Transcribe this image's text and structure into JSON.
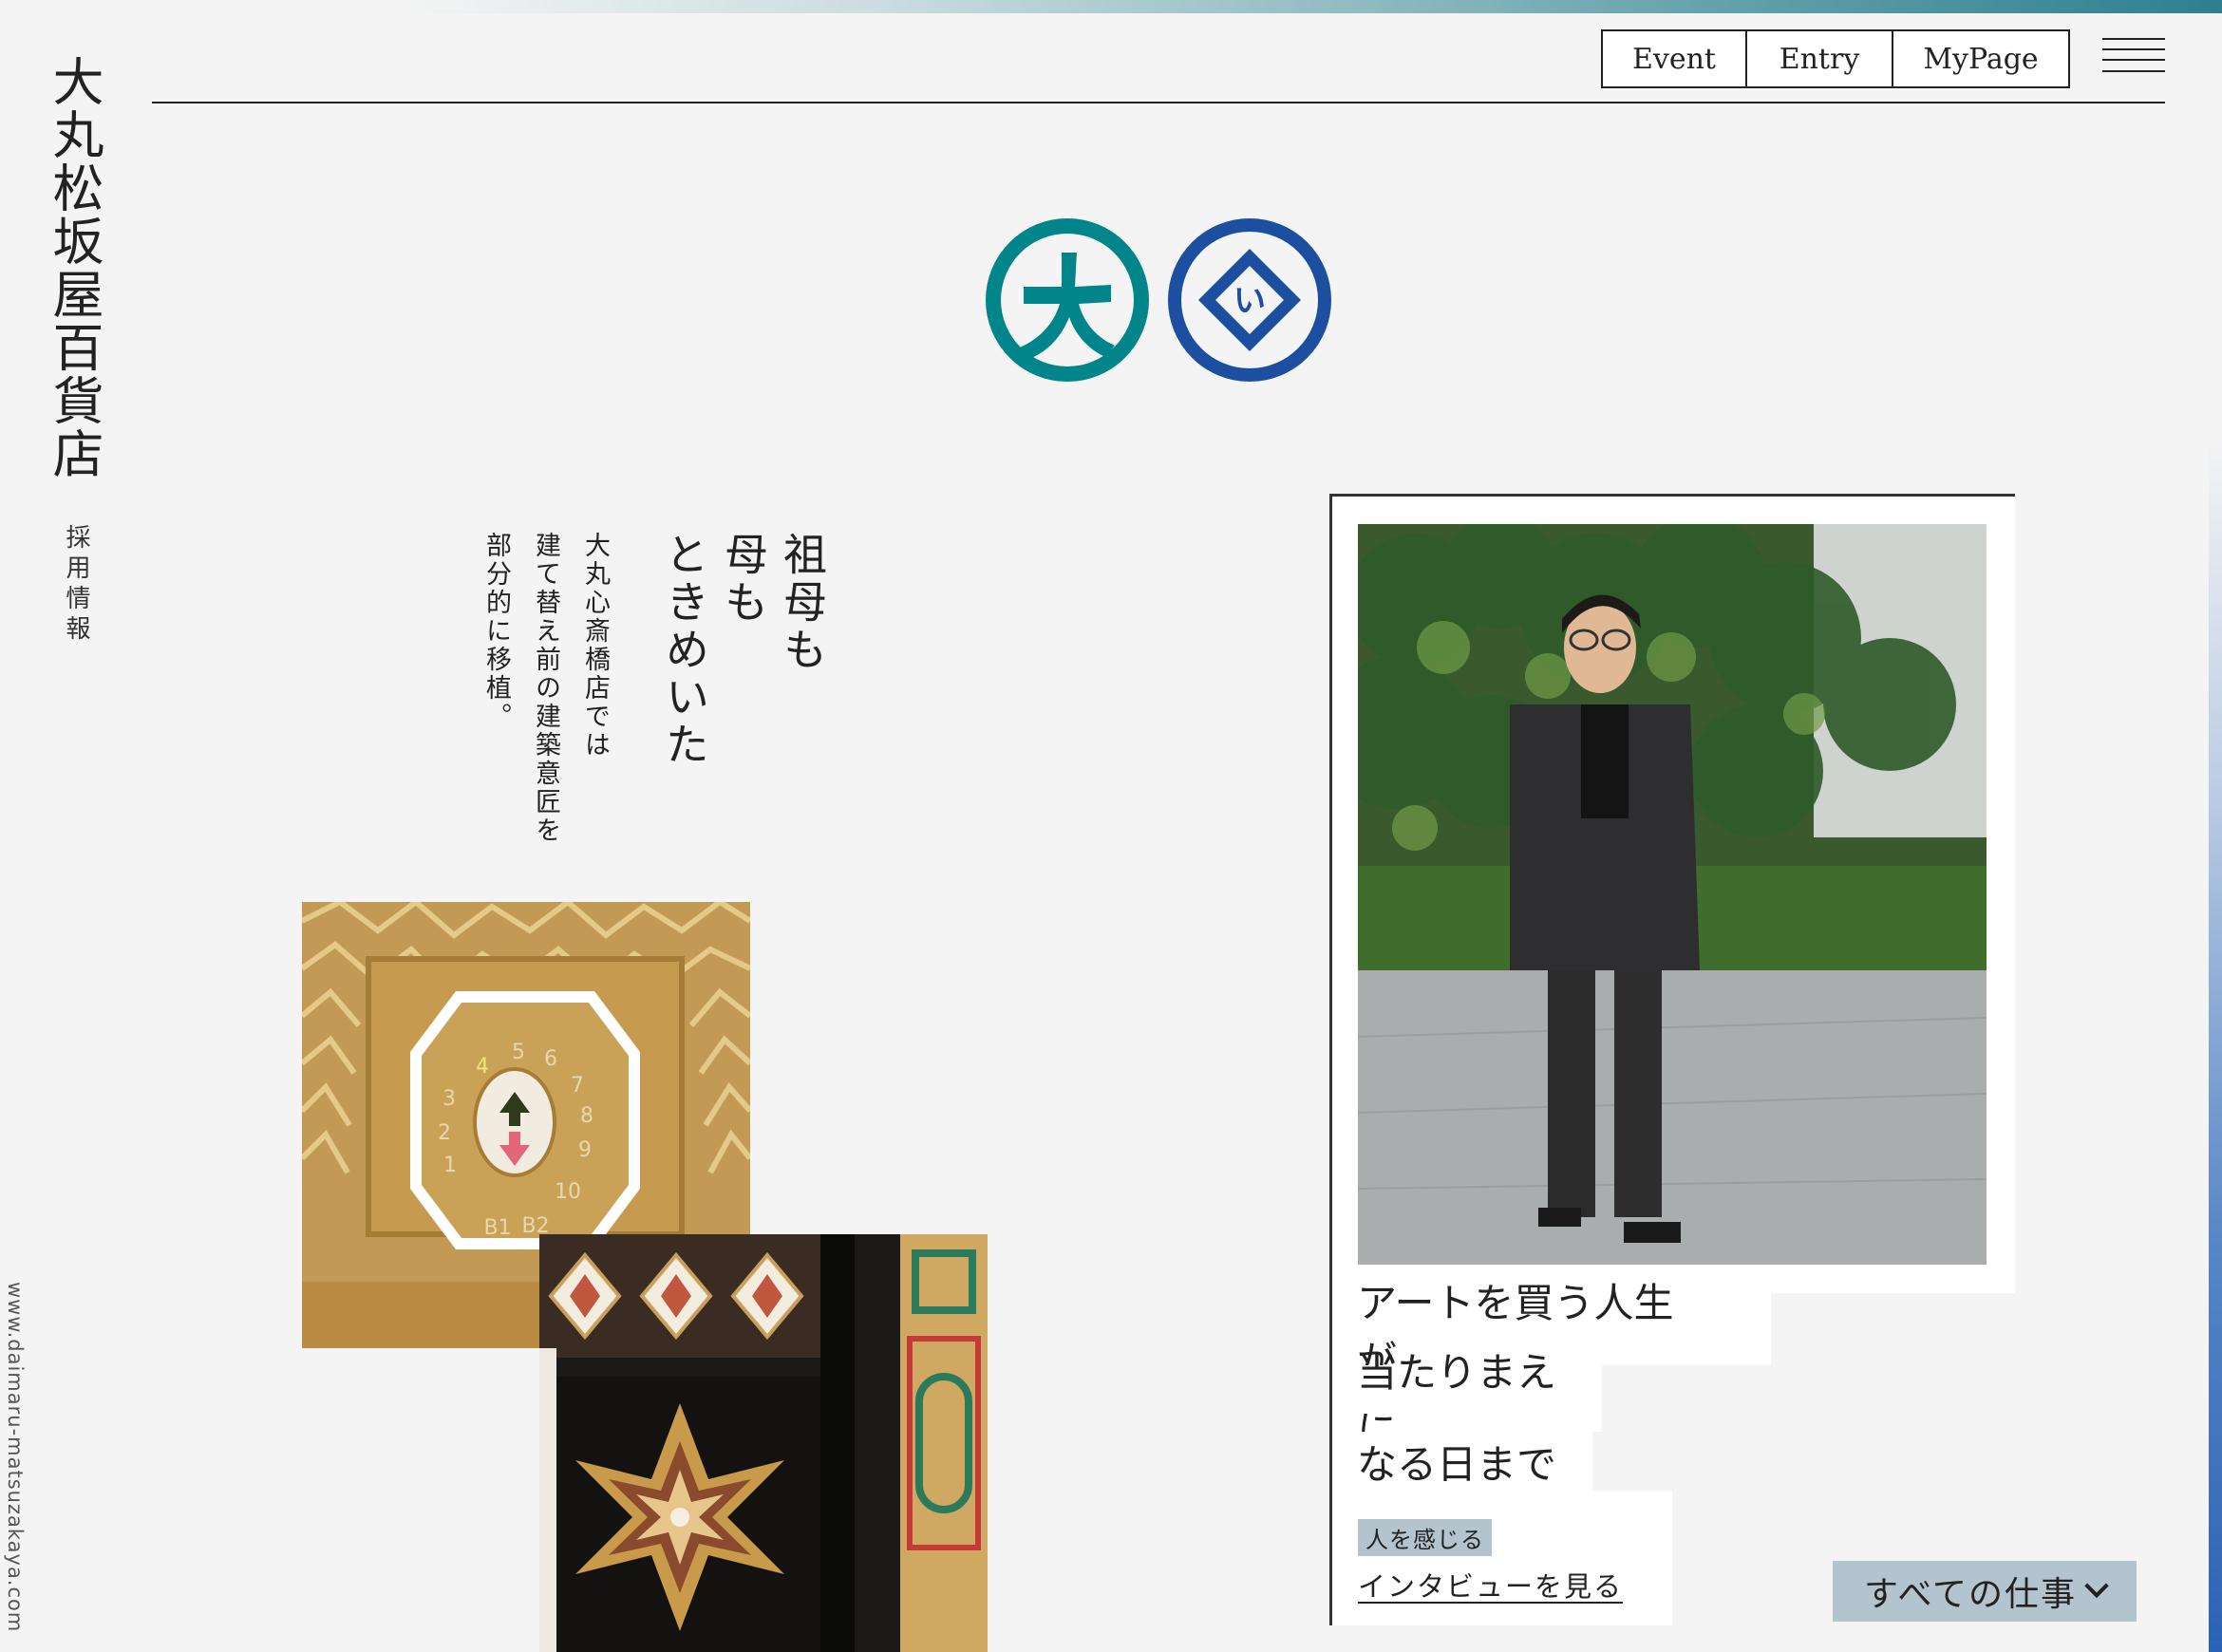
{
  "brand": {
    "name": "大丸松坂屋百貨店",
    "subtitle": "採用情報",
    "url": "www.daimaru-matsuzakaya.com"
  },
  "nav": {
    "items": [
      "Event",
      "Entry",
      "MyPage"
    ],
    "menu_icon": "hamburger-menu-icon"
  },
  "logos": [
    {
      "name": "daimaru-logo",
      "glyph": "大",
      "color": "#00868a"
    },
    {
      "name": "matsuzakaya-logo",
      "glyph": "い",
      "color": "#1d4fa0"
    }
  ],
  "feature": {
    "headline": "祖母も\n母も\nときめいた",
    "body": "大丸心斎橋店では\n建て替え前の建築意匠を\n部分的に移植。"
  },
  "interview": {
    "title_lines": [
      "アートを買う人生が、",
      "当たりまえに",
      "なる日まで"
    ],
    "tag": "人を感じる",
    "link": "インタビューを見る"
  },
  "jobs_button": "すべての仕事",
  "colors": {
    "accent_teal": "#00868a",
    "accent_blue": "#1d4fa0",
    "tag_bg": "#b3c4cf"
  }
}
